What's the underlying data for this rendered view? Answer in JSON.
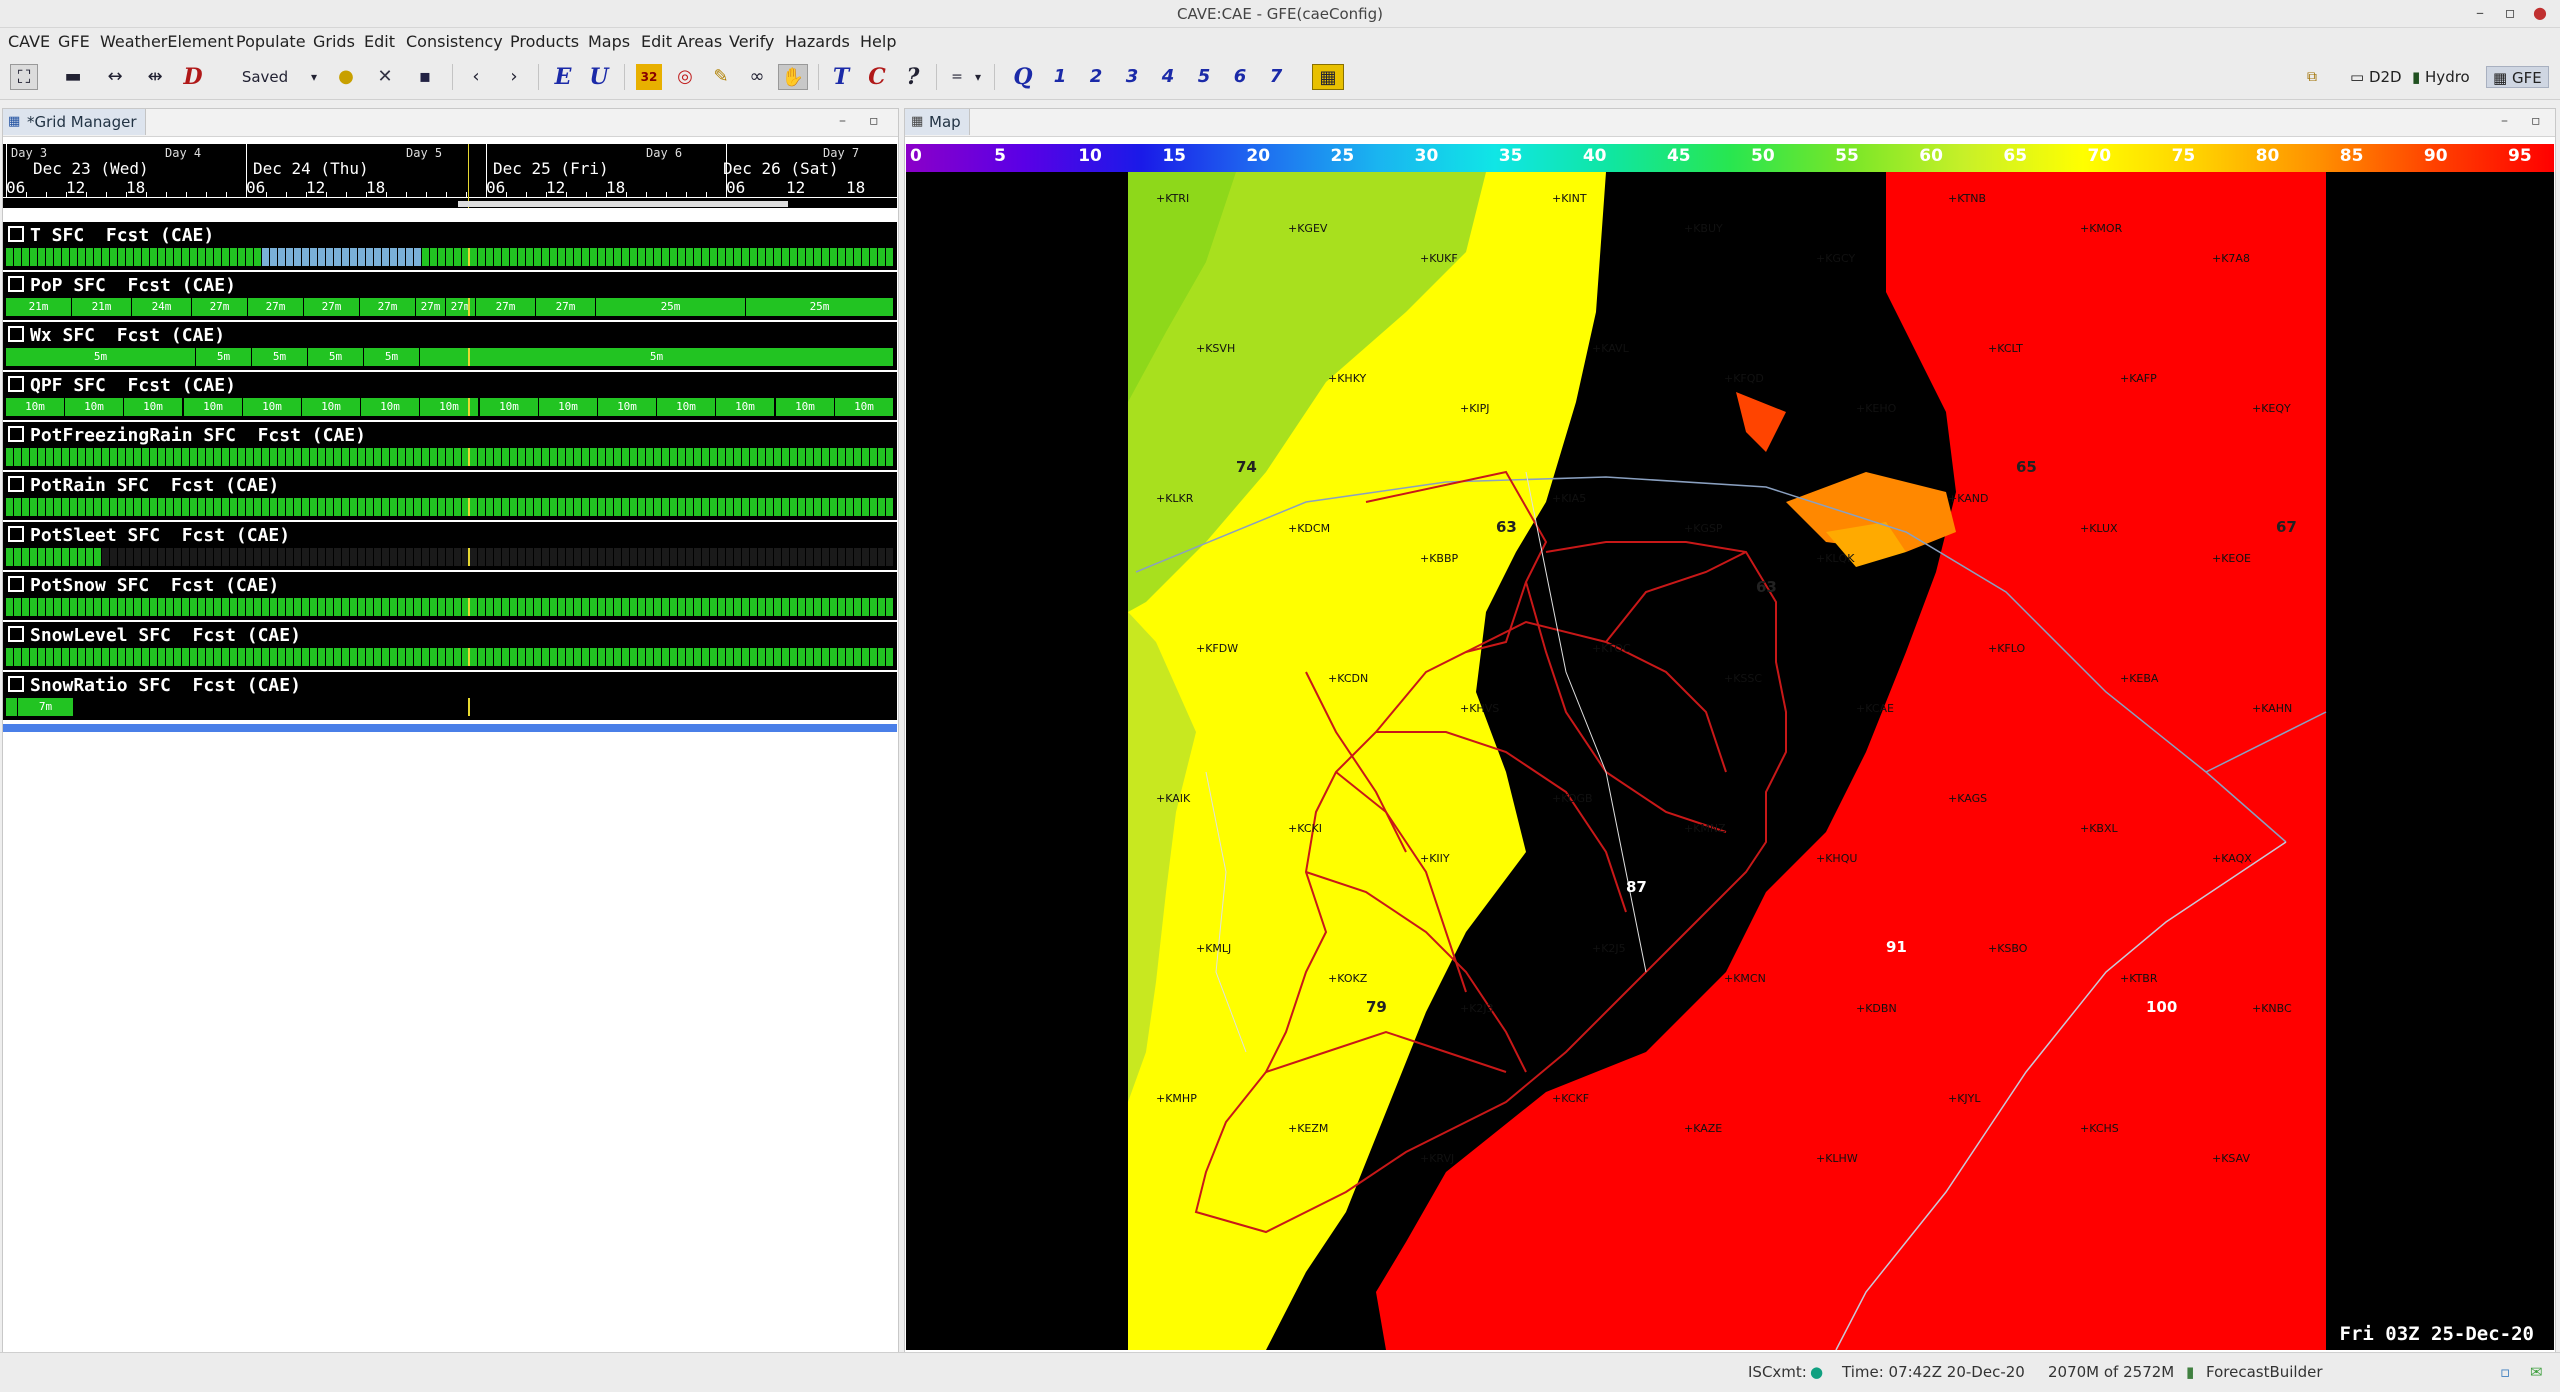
{
  "window": {
    "title": "CAVE:CAE - GFE(caeConfig)"
  },
  "menu": [
    "CAVE",
    "GFE",
    "WeatherElement",
    "Populate",
    "Grids",
    "Edit",
    "Consistency",
    "Products",
    "Maps",
    "Edit Areas",
    "Verify",
    "Hazards",
    "Help"
  ],
  "toolbar": {
    "saved_label": "Saved",
    "e_label": "E",
    "u_label": "U",
    "d_label": "D",
    "t_label": "T",
    "c_label": "C",
    "q_label": "?",
    "qq_label": "Q",
    "nums": [
      "1",
      "2",
      "3",
      "4",
      "5",
      "6",
      "7"
    ],
    "perspectives": [
      "D2D",
      "Hydro",
      "GFE"
    ]
  },
  "grid_manager": {
    "tab_label": "*Grid Manager",
    "days_top": [
      "Day 3",
      "Day 4",
      "Day 5",
      "Day 6",
      "Day 7"
    ],
    "days": [
      "Dec 23 (Wed)",
      "Dec 24 (Thu)",
      "Dec 25 (Fri)",
      "Dec 26 (Sat)"
    ],
    "hours": [
      "06",
      "12",
      "18",
      "06",
      "12",
      "18",
      "06",
      "12",
      "18",
      "06",
      "12",
      "18"
    ],
    "rows": [
      {
        "name": "T SFC  Fcst (CAE)",
        "type": "T"
      },
      {
        "name": "PoP SFC  Fcst (CAE)",
        "type": "PoP",
        "labels": [
          "21m",
          "21m",
          "24m",
          "27m",
          "27m",
          "27m",
          "27m",
          "27m",
          "27m",
          "27m",
          "27m",
          "25m",
          "25m"
        ]
      },
      {
        "name": "Wx SFC  Fcst (CAE)",
        "type": "Wx",
        "labels": [
          "5m",
          "5m",
          "5m",
          "5m",
          "5m",
          "5m"
        ]
      },
      {
        "name": "QPF SFC  Fcst (CAE)",
        "type": "QPF",
        "labels": [
          "10m",
          "10m",
          "10m",
          "10m",
          "10m",
          "10m",
          "10m",
          "10m",
          "10m",
          "10m",
          "10m",
          "10m",
          "10m",
          "10m",
          "10m"
        ]
      },
      {
        "name": "PotFreezingRain SFC  Fcst (CAE)",
        "type": "hourly"
      },
      {
        "name": "PotRain SFC  Fcst (CAE)",
        "type": "hourly"
      },
      {
        "name": "PotSleet SFC  Fcst (CAE)",
        "type": "short"
      },
      {
        "name": "PotSnow SFC  Fcst (CAE)",
        "type": "hourly"
      },
      {
        "name": "SnowLevel SFC  Fcst (CAE)",
        "type": "hourly"
      },
      {
        "name": "SnowRatio SFC  Fcst (CAE)",
        "type": "ratio",
        "labels": [
          "7m"
        ]
      }
    ]
  },
  "map": {
    "tab_label": "Map",
    "colorbar_labels": [
      "0",
      "5",
      "10",
      "15",
      "20",
      "25",
      "30",
      "35",
      "40",
      "45",
      "50",
      "55",
      "60",
      "65",
      "70",
      "75",
      "80",
      "85",
      "90",
      "95"
    ],
    "colorbar_colors": [
      "#8b00c8",
      "#5a00e6",
      "#1a1ae8",
      "#1f6cf0",
      "#1ab4f0",
      "#10e6e6",
      "#10e6a0",
      "#28e650",
      "#78e628",
      "#c8f028",
      "#ffff00",
      "#ffd000",
      "#ff9000",
      "#ff4000",
      "#ff0000"
    ],
    "valid_time": "Fri 03Z 25-Dec-20",
    "stations": [
      "KTRI",
      "KGEV",
      "KUKF",
      "KINT",
      "KBUY",
      "KGCY",
      "KTNB",
      "KMOR",
      "K7A8",
      "KSVH",
      "KHKY",
      "KIPJ",
      "KAVL",
      "KFQD",
      "KEHO",
      "KCLT",
      "KAFP",
      "KEQY",
      "KLKR",
      "KDCM",
      "KBBP",
      "KIA5",
      "KGSP",
      "KLQK",
      "KAND",
      "KLUX",
      "KEOE",
      "KFDW",
      "KCDN",
      "KHVS",
      "KTOC",
      "KSSC",
      "KCAE",
      "KFLO",
      "KEBA",
      "KAHN",
      "KAIK",
      "KCKI",
      "KIIY",
      "KOGB",
      "KMNZ",
      "KHQU",
      "KAGS",
      "KBXL",
      "KAQX",
      "KMLJ",
      "KOKZ",
      "K2J3",
      "K2J5",
      "KMCN",
      "KDBN",
      "KSBO",
      "KTBR",
      "KNBC",
      "KMHP",
      "KEZM",
      "KRVJ",
      "KCKF",
      "KAZE",
      "KLHW",
      "KJYL",
      "KCHS",
      "KSAV"
    ],
    "values": [
      "74",
      "63",
      "63",
      "65",
      "67",
      "79",
      "87",
      "91",
      "100"
    ]
  },
  "status": {
    "isc_label": "ISCxmt:",
    "time_label": "Time: 07:42Z 20-Dec-20",
    "memory": "2070M of 2572M",
    "app": "ForecastBuilder"
  }
}
